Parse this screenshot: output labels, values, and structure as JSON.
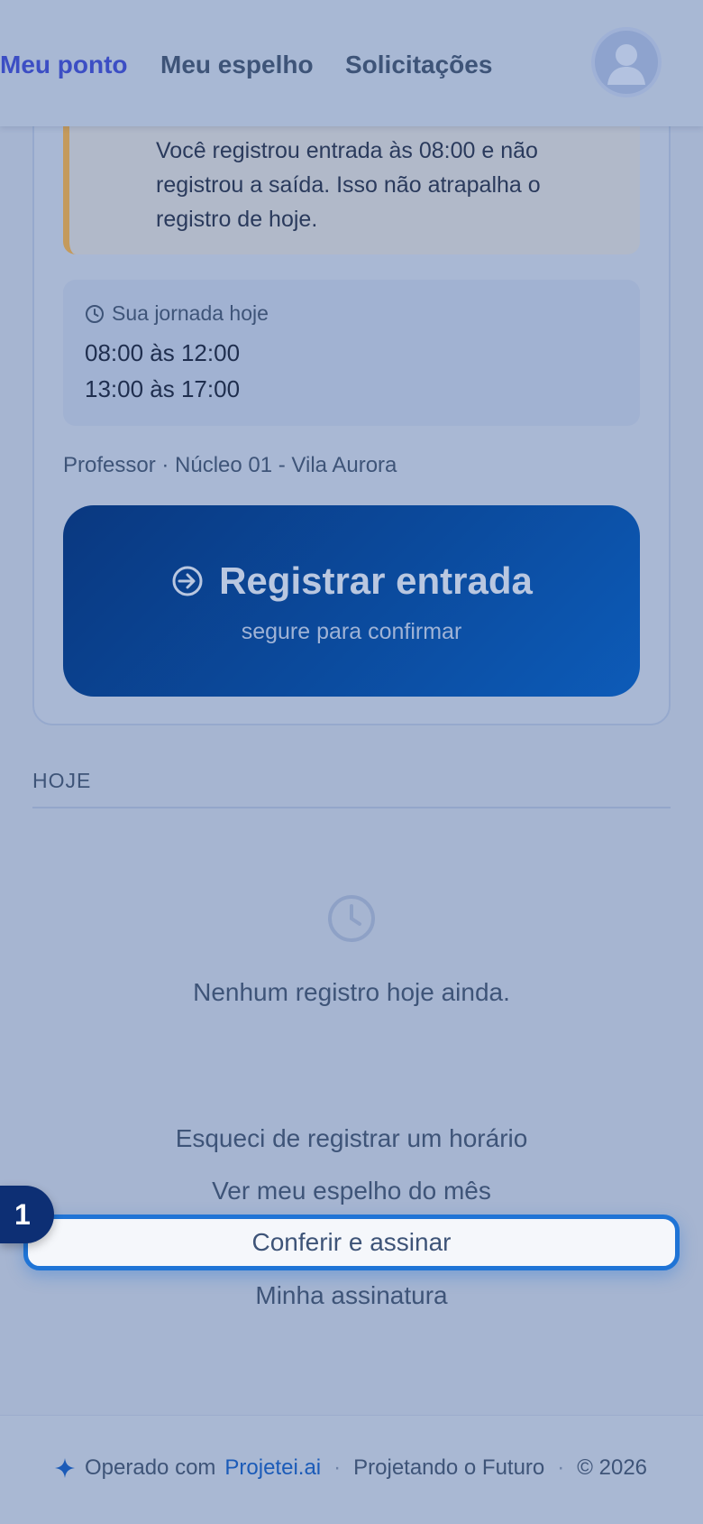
{
  "header": {
    "nav": [
      {
        "label": "Meu ponto",
        "active": true
      },
      {
        "label": "Meu espelho",
        "active": false
      },
      {
        "label": "Solicitações",
        "active": false
      }
    ],
    "avatar_icon": "user-avatar-icon"
  },
  "warning": {
    "text": "Você registrou entrada às 08:00 e não registrou a saída. Isso não atrapalha o registro de hoje."
  },
  "schedule": {
    "title": "Sua jornada hoje",
    "icon": "clock-icon",
    "lines": [
      "08:00 às 12:00",
      "13:00 às 17:00"
    ]
  },
  "role_line": "Professor · Núcleo 01 - Vila Aurora",
  "register_button": {
    "label": "Registrar entrada",
    "sublabel": "segure para confirmar",
    "icon": "login-arrow-icon"
  },
  "today": {
    "section_label": "HOJE",
    "empty_icon": "clock-icon",
    "empty_text": "Nenhum registro hoje ainda."
  },
  "links": {
    "forgot": "Esqueci de registrar um horário",
    "mirror": "Ver meu espelho do mês",
    "sign": "Conferir e assinar",
    "my_signature": "Minha assinatura"
  },
  "step_badge": "1",
  "footer": {
    "icon": "sparkle-icon",
    "operated_prefix": "Operado com",
    "brand": "Projetei.ai",
    "slogan": "Projetando o Futuro",
    "copyright": "© 2026"
  },
  "colors": {
    "accent": "#3c4ec4",
    "primary_button": "#0b4b9e",
    "highlight_border": "#1f74d6",
    "warning_border": "#c49a5c",
    "brand_link": "#1b5bb8"
  }
}
